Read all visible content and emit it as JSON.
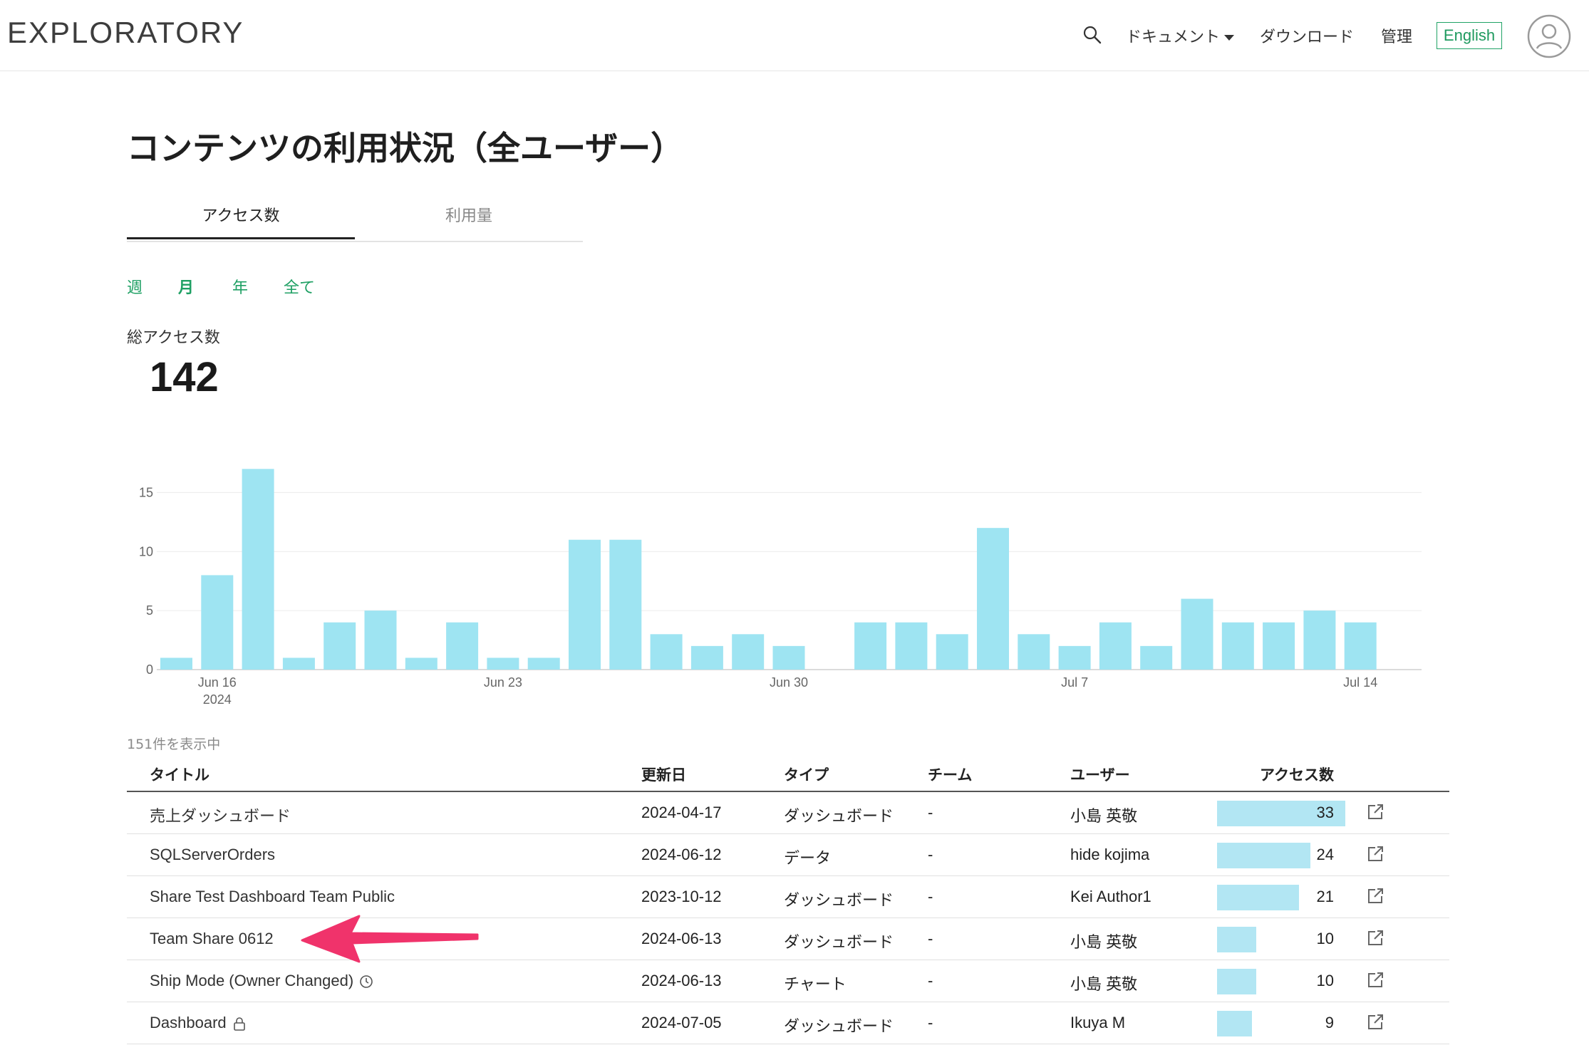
{
  "header": {
    "logo": "EXPLORATORY",
    "search_icon": "search-icon",
    "nav": {
      "documents": "ドキュメント",
      "download": "ダウンロード",
      "admin": "管理",
      "language": "English"
    },
    "avatar_icon": "user-avatar-icon",
    "accent_color": "#21a366"
  },
  "page": {
    "title": "コンテンツの利用状況（全ユーザー）",
    "tabs": [
      {
        "label": "アクセス数",
        "active": true
      },
      {
        "label": "利用量",
        "active": false
      }
    ],
    "periods": [
      {
        "label": "週",
        "active": false
      },
      {
        "label": "月",
        "active": true
      },
      {
        "label": "年",
        "active": false
      },
      {
        "label": "全て",
        "active": false
      }
    ],
    "total_label": "総アクセス数",
    "total_value": "142"
  },
  "chart_data": {
    "type": "bar",
    "title": "",
    "xlabel": "",
    "ylabel": "",
    "x": [
      "2024-06-15",
      "2024-06-16",
      "2024-06-17",
      "2024-06-18",
      "2024-06-19",
      "2024-06-20",
      "2024-06-21",
      "2024-06-22",
      "2024-06-23",
      "2024-06-24",
      "2024-06-25",
      "2024-06-26",
      "2024-06-27",
      "2024-06-28",
      "2024-06-29",
      "2024-06-30",
      "2024-07-01",
      "2024-07-02",
      "2024-07-03",
      "2024-07-04",
      "2024-07-05",
      "2024-07-06",
      "2024-07-07",
      "2024-07-08",
      "2024-07-09",
      "2024-07-10",
      "2024-07-11",
      "2024-07-12",
      "2024-07-13",
      "2024-07-14"
    ],
    "values": [
      1,
      8,
      17,
      1,
      4,
      5,
      1,
      4,
      1,
      1,
      11,
      11,
      3,
      2,
      3,
      2,
      0,
      4,
      4,
      3,
      12,
      3,
      2,
      4,
      2,
      6,
      4,
      4,
      5,
      4
    ],
    "ylim": [
      0,
      17.5
    ],
    "y_ticks": [
      "0",
      "5",
      "10",
      "15"
    ],
    "x_tick_labels": [
      {
        "label": "Jun 16",
        "sub": "2024",
        "x": "2024-06-16"
      },
      {
        "label": "Jun 23",
        "sub": "",
        "x": "2024-06-23"
      },
      {
        "label": "Jun 30",
        "sub": "",
        "x": "2024-06-30"
      },
      {
        "label": "Jul 7",
        "sub": "",
        "x": "2024-07-07"
      },
      {
        "label": "Jul 14",
        "sub": "",
        "x": "2024-07-14"
      }
    ],
    "bar_color": "#9ee4f2",
    "grid": true
  },
  "table": {
    "count_label": "151件を表示中",
    "headers": {
      "title": "タイトル",
      "updated": "更新日",
      "type": "タイプ",
      "team": "チーム",
      "user": "ユーザー",
      "access": "アクセス数"
    },
    "max_access": 33,
    "rows": [
      {
        "title": "売上ダッシュボード",
        "updated": "2024-04-17",
        "type": "ダッシュボード",
        "team": "-",
        "user": "小島 英敬",
        "access": 33,
        "icon": ""
      },
      {
        "title": "SQLServerOrders",
        "updated": "2024-06-12",
        "type": "データ",
        "team": "-",
        "user": "hide kojima",
        "access": 24,
        "icon": ""
      },
      {
        "title": "Share Test Dashboard Team Public",
        "updated": "2023-10-12",
        "type": "ダッシュボード",
        "team": "-",
        "user": "Kei Author1",
        "access": 21,
        "icon": ""
      },
      {
        "title": "Team Share 0612",
        "updated": "2024-06-13",
        "type": "ダッシュボード",
        "team": "-",
        "user": "小島 英敬",
        "access": 10,
        "icon": ""
      },
      {
        "title": "Ship Mode (Owner Changed)",
        "updated": "2024-06-13",
        "type": "チャート",
        "team": "-",
        "user": "小島 英敬",
        "access": 10,
        "icon": "clock-icon"
      },
      {
        "title": "Dashboard",
        "updated": "2024-07-05",
        "type": "ダッシュボード",
        "team": "-",
        "user": "Ikuya M",
        "access": 9,
        "icon": "lock-icon"
      }
    ],
    "row_link_icon": "external-link-icon",
    "access_bar_color": "#b2e6f3"
  },
  "annotation": {
    "arrow_color": "#f0336b",
    "arrow_target": "Team Share 0612"
  }
}
